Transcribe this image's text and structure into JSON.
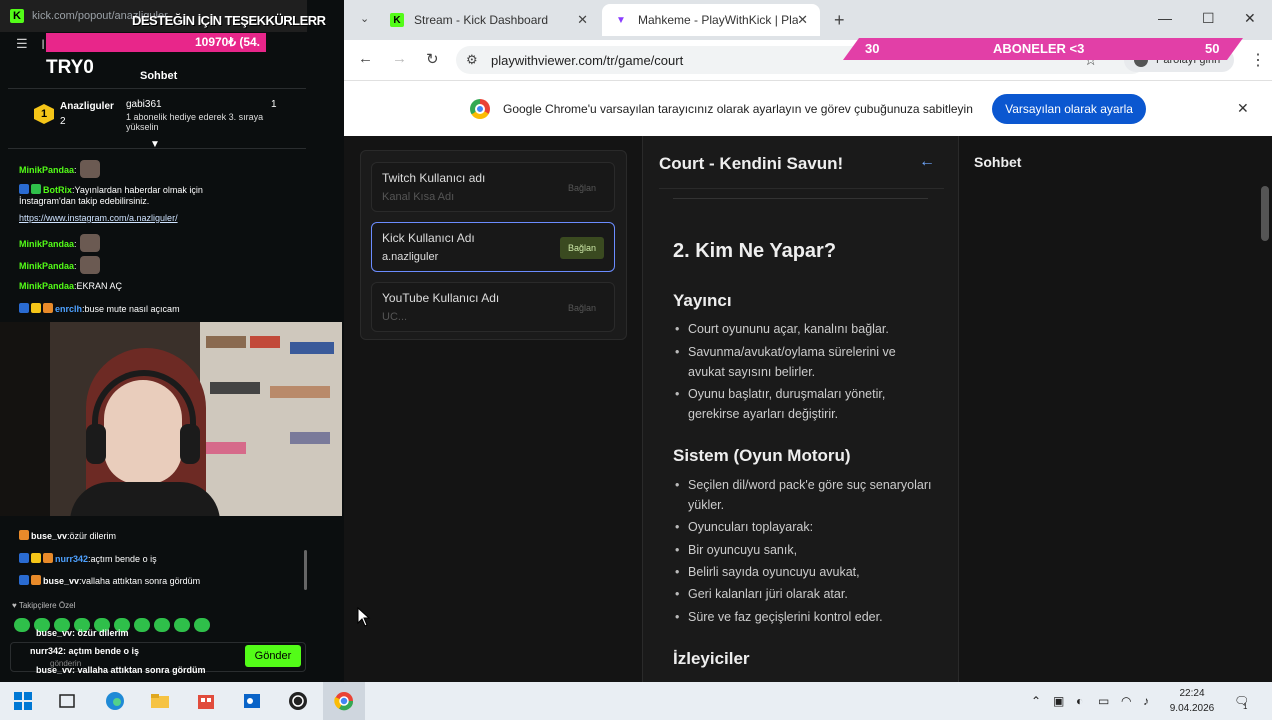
{
  "left_window": {
    "url": "kick.com/popout/anazliguler",
    "overlay_title": "DESTEĞİN İÇİN TEŞEKKÜRLERR",
    "goal_text": "10970₺ (54.",
    "toolbar_letter": "l",
    "username": "TRY0",
    "chat_header": "Sohbet",
    "pinned": {
      "badge": "1",
      "name": "Anazliguler",
      "count": "2",
      "gifter": "gabi361",
      "gifter_count": "1",
      "description": "1 abonelik hediye ederek 3. sıraya yükselin"
    },
    "messages": [
      {
        "user": "MinikPandaa",
        "text": ":"
      },
      {
        "user": "BotRix",
        "text": ":Yayınlardan haberdar olmak için İnstagram'dan takip edebilirsiniz."
      },
      {
        "user": "",
        "text": "https://www.instagram.com/a.nazliguler/"
      },
      {
        "user": "MinikPandaa",
        "text": ":"
      },
      {
        "user": "MinikPandaa",
        "text": ":"
      },
      {
        "user": "MinikPandaa",
        "text": ":EKRAN AÇ"
      },
      {
        "user": "enrclh",
        "text": ":buse mute nasıl açıcam"
      }
    ],
    "lower_messages": [
      {
        "user": "buse_vv",
        "text": ":özür dilerim"
      },
      {
        "user": "nurr342",
        "text": ":açtım bende o iş"
      },
      {
        "user": "buse_vv",
        "text": ":vallaha attıktan sonra gördüm"
      }
    ],
    "followers_only": "Takipçilere Özel",
    "overlay_msgs": [
      {
        "user": "buse_vv",
        "text": ": özür dilerim"
      },
      {
        "user": "nurr342",
        "text": ": açtım bende o iş"
      },
      {
        "user": "buse_vv",
        "text": ": vallaha attıktan sonra gördüm"
      }
    ],
    "input_placeholder": "gönderin",
    "send_label": "Gönder"
  },
  "browser": {
    "tabs": [
      {
        "title": "Stream - Kick Dashboard",
        "active": false
      },
      {
        "title": "Mahkeme - PlayWithKick | Play",
        "active": true
      }
    ],
    "url": "playwithviewer.com/tr/game/court",
    "password_label": "Parolayı girin",
    "infobar_text": "Google Chrome'u varsayılan tarayıcınız olarak ayarlayın ve görev çubuğunuza sabitleyin",
    "infobar_button": "Varsayılan olarak ayarla"
  },
  "sub_overlay": {
    "left": "30",
    "label": "ABONELER <3",
    "right": "50"
  },
  "connections": [
    {
      "label": "Twitch Kullanıcı adı",
      "value": "Kanal Kısa Adı",
      "button": "Bağlan",
      "active": false
    },
    {
      "label": "Kick Kullanıcı Adı",
      "value": "a.nazliguler",
      "button": "Bağlan",
      "active": true
    },
    {
      "label": "YouTube Kullanıcı Adı",
      "value": "UC...",
      "button": "Bağlan",
      "active": false
    }
  ],
  "court": {
    "title": "Court - Kendini Savun!",
    "section": "2. Kim Ne Yapar?",
    "yayinci_title": "Yayıncı",
    "yayinci": [
      "Court oyununu açar, kanalını bağlar.",
      "Savunma/avukat/oylama sürelerini ve avukat sayısını belirler.",
      "Oyunu başlatır, duruşmaları yönetir, gerekirse ayarları değiştirir."
    ],
    "sistem_title": "Sistem (Oyun Motoru)",
    "sistem": [
      "Seçilen dil/word pack'e göre suç senaryoları yükler.",
      "Oyuncuları toplayarak:",
      "Bir oyuncuyu sanık,",
      "Belirli sayıda oyuncuyu avukat,",
      "Geri kalanları jüri olarak atar.",
      "Süre ve faz geçişlerini kontrol eder."
    ],
    "izleyiciler_title": "İzleyiciler"
  },
  "side_chat_title": "Sohbet",
  "taskbar": {
    "time": "22:24",
    "date": "9.04.2026",
    "notif_count": "1"
  }
}
